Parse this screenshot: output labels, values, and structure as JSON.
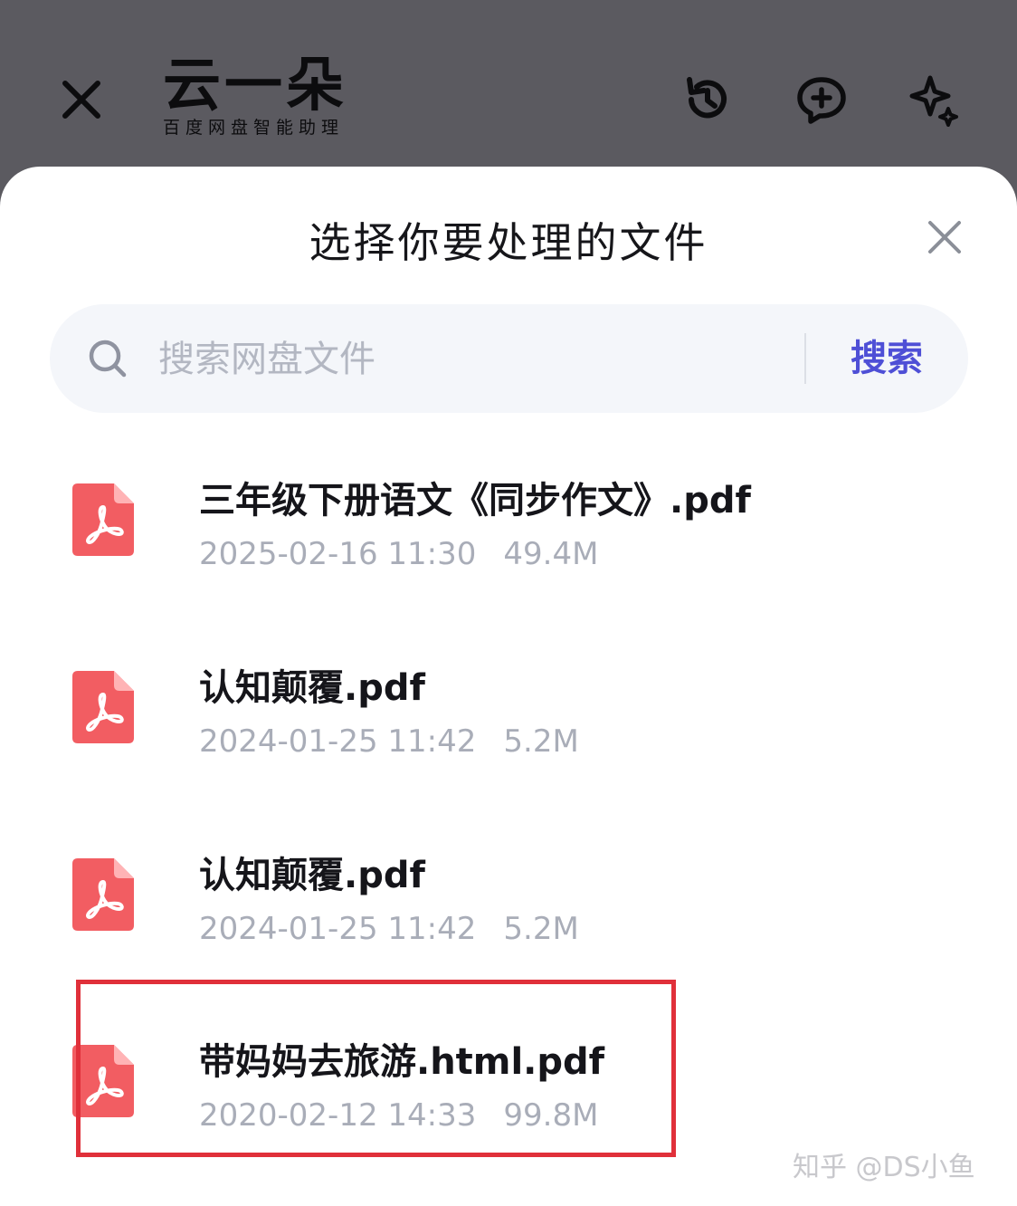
{
  "app_header": {
    "logo_title": "云一朵",
    "logo_subtitle": "百度网盘智能助理",
    "icons": [
      "close-icon",
      "history-icon",
      "new-chat-icon",
      "sparkle-icon"
    ]
  },
  "sheet": {
    "title": "选择你要处理的文件",
    "close_icon": "close-icon"
  },
  "search": {
    "placeholder": "搜索网盘文件",
    "value": "",
    "button_label": "搜索",
    "accent_color": "#4e4fd6"
  },
  "files": [
    {
      "name": "三年级下册语文《同步作文》.pdf",
      "date": "2025-02-16 11:30",
      "size": "49.4M",
      "icon": "pdf-icon"
    },
    {
      "name": "认知颠覆.pdf",
      "date": "2024-01-25 11:42",
      "size": "5.2M",
      "icon": "pdf-icon"
    },
    {
      "name": "认知颠覆.pdf",
      "date": "2024-01-25 11:42",
      "size": "5.2M",
      "icon": "pdf-icon"
    },
    {
      "name": "带妈妈去旅游.html.pdf",
      "date": "2020-02-12 14:33",
      "size": "99.8M",
      "icon": "pdf-icon",
      "highlighted": true
    }
  ],
  "colors": {
    "pdf_icon": "#f25d62",
    "highlight": "#e0303a"
  },
  "watermark": "知乎 @DS小鱼"
}
